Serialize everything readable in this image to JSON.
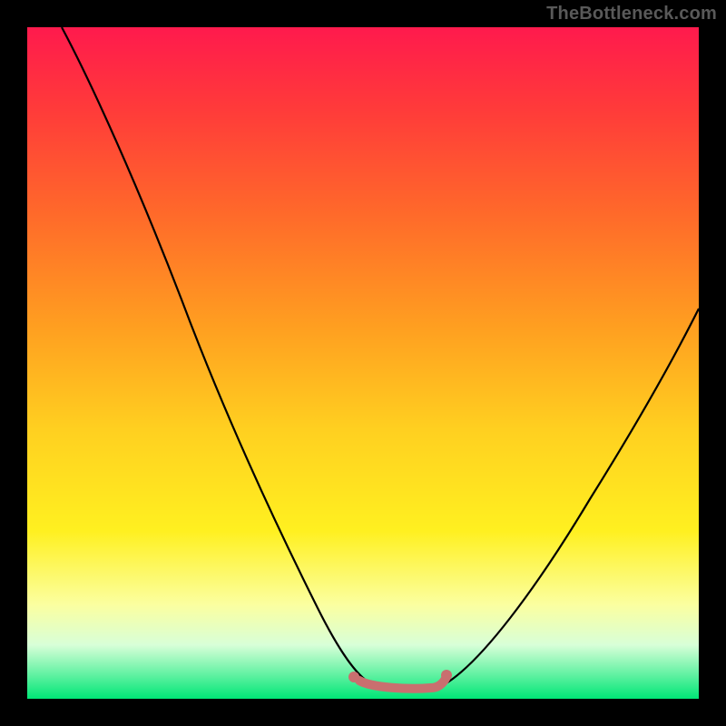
{
  "attribution": "TheBottleneck.com",
  "chart_data": {
    "type": "line",
    "title": "",
    "xlabel": "",
    "ylabel": "",
    "xlim": [
      0,
      100
    ],
    "ylim": [
      0,
      100
    ],
    "grid": false,
    "legend": false,
    "series": [
      {
        "name": "left-curve",
        "x": [
          5,
          10,
          15,
          20,
          25,
          30,
          35,
          40,
          45,
          48,
          50,
          52
        ],
        "values": [
          100,
          88,
          77,
          67,
          57,
          47,
          37,
          27,
          17,
          9,
          5,
          3
        ],
        "color": "#000000"
      },
      {
        "name": "right-curve",
        "x": [
          62,
          65,
          70,
          75,
          80,
          85,
          90,
          95,
          100
        ],
        "values": [
          3,
          6,
          12,
          20,
          28,
          36,
          44,
          52,
          60
        ],
        "color": "#000000"
      },
      {
        "name": "bottom-segment",
        "x": [
          49,
          52,
          56,
          60,
          62
        ],
        "values": [
          3,
          2,
          2,
          2,
          4
        ],
        "color": "#c96f6f"
      }
    ],
    "markers": [
      {
        "name": "left-dot",
        "x": 49,
        "y": 3,
        "color": "#c96f6f"
      },
      {
        "name": "right-dot",
        "x": 62,
        "y": 4,
        "color": "#c96f6f"
      }
    ]
  }
}
